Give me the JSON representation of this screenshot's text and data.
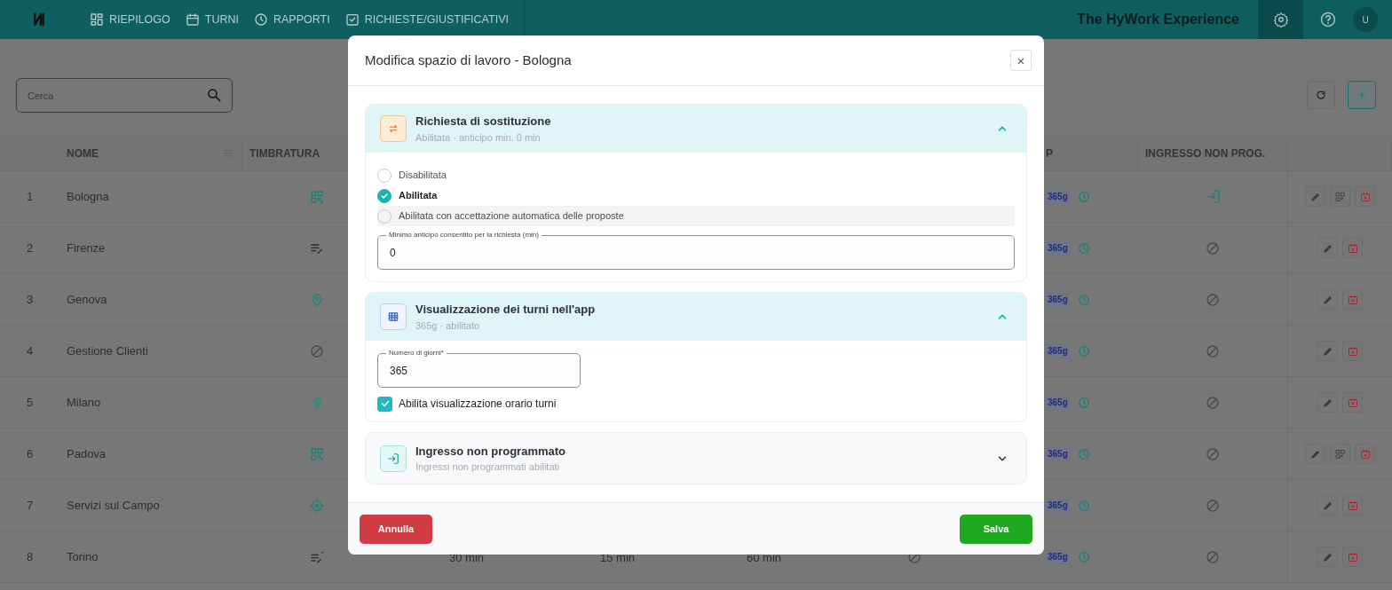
{
  "navbar": {
    "nav_items": [
      {
        "label": "RIEPILOGO"
      },
      {
        "label": "TURNI"
      },
      {
        "label": "RAPPORTI"
      },
      {
        "label": "RICHIESTE/GIUSTIFICATIVI"
      }
    ],
    "brand": "The HyWork Experience",
    "avatar": "U"
  },
  "search": {
    "placeholder": "Cerca"
  },
  "table": {
    "columns": [
      {},
      {
        "label": "NOME"
      },
      {
        "label": "TIMBRATURA"
      },
      {},
      {},
      {},
      {},
      {},
      {
        "label": "P"
      },
      {
        "label": "INGRESSO NON PROG."
      },
      {}
    ],
    "rows": [
      {
        "number": "1",
        "name": "Bologna",
        "timbratura": {
          "kind": "qr"
        },
        "app_days": "365g",
        "ingresso_enabled": true,
        "qr_action": true
      },
      {
        "number": "2",
        "name": "Firenze",
        "timbratura": {
          "kind": "manual"
        },
        "app_days": "365g",
        "ingresso_enabled": false,
        "qr_action": false
      },
      {
        "number": "3",
        "name": "Genova",
        "timbratura": {
          "kind": "gps"
        },
        "app_days": "365g",
        "ingresso_enabled": false,
        "qr_action": false
      },
      {
        "number": "4",
        "name": "Gestione Clienti",
        "timbratura": {
          "kind": "none"
        },
        "app_days": "365g",
        "ingresso_enabled": false,
        "qr_action": false
      },
      {
        "number": "5",
        "name": "Milano",
        "timbratura": {
          "kind": "fingerprint"
        },
        "app_days": "365g",
        "ingresso_enabled": false,
        "qr_action": false
      },
      {
        "number": "6",
        "name": "Padova",
        "timbratura": {
          "kind": "qr"
        },
        "app_days": "365g",
        "ingresso_enabled": false,
        "qr_action": true
      },
      {
        "number": "7",
        "name": "Servizi sul Campo",
        "timbratura": {
          "kind": "target"
        },
        "app_days": "365g",
        "ingresso_enabled": false,
        "qr_action": false
      },
      {
        "number": "8",
        "name": "Torino",
        "timbratura": {
          "kind": "manual_dot"
        },
        "column_3": "30 min",
        "column_4": "15 min",
        "column_5": "60 min",
        "column_6_enabled": false,
        "app_days": "365g",
        "ingresso_enabled": false,
        "qr_action": false
      }
    ]
  },
  "modal": {
    "title": "Modifica spazio di lavoro - Bologna",
    "close": "×",
    "sections": [
      {
        "kind": "substitution",
        "title": "Richiesta di sostituzione",
        "subtitle": "Abilitata · anticipo min. 0 min",
        "expanded": true,
        "radios": [
          {
            "label": "Disabilitata",
            "selected": false,
            "highlighted": false
          },
          {
            "label": "Abilitata",
            "selected": true,
            "highlighted": false
          },
          {
            "label": "Abilitata con accettazione automatica delle proposte",
            "selected": false,
            "highlighted": true
          }
        ],
        "field": {
          "label": "Minimo anticipo consentito per la richiesta (min)",
          "value": "0"
        }
      },
      {
        "kind": "shifts",
        "title": "Visualizzazione dei turni nell'app",
        "subtitle": "365g · abilitato",
        "expanded": true,
        "field": {
          "label": "Numero di giorni*",
          "value": "365"
        },
        "checkbox": {
          "label": "Abilita visualizzazione orario turni",
          "checked": true
        }
      },
      {
        "kind": "unscheduled",
        "title": "Ingresso non programmato",
        "subtitle": "Ingressi non programmati abilitati",
        "expanded": false
      }
    ],
    "buttons": {
      "cancel": "Annulla",
      "save": "Salva"
    }
  }
}
